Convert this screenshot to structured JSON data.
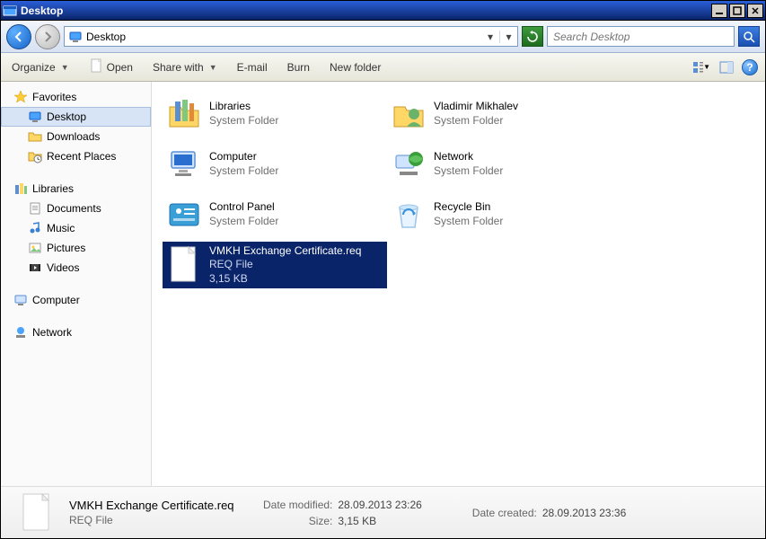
{
  "window": {
    "title": "Desktop"
  },
  "address": {
    "location": "Desktop"
  },
  "search": {
    "placeholder": "Search Desktop"
  },
  "toolbar": {
    "organize": "Organize",
    "open": "Open",
    "share": "Share with",
    "email": "E-mail",
    "burn": "Burn",
    "newfolder": "New folder"
  },
  "sidebar": {
    "favorites": {
      "label": "Favorites",
      "items": [
        {
          "label": "Desktop",
          "icon": "desktop",
          "selected": true
        },
        {
          "label": "Downloads",
          "icon": "downloads"
        },
        {
          "label": "Recent Places",
          "icon": "recent"
        }
      ]
    },
    "libraries": {
      "label": "Libraries",
      "items": [
        {
          "label": "Documents",
          "icon": "documents"
        },
        {
          "label": "Music",
          "icon": "music"
        },
        {
          "label": "Pictures",
          "icon": "pictures"
        },
        {
          "label": "Videos",
          "icon": "videos"
        }
      ]
    },
    "computer": {
      "label": "Computer"
    },
    "network": {
      "label": "Network"
    }
  },
  "items": [
    {
      "name": "Libraries",
      "sub1": "System Folder",
      "icon": "libraries"
    },
    {
      "name": "Vladimir Mikhalev",
      "sub1": "System Folder",
      "icon": "user"
    },
    {
      "name": "Computer",
      "sub1": "System Folder",
      "icon": "computer"
    },
    {
      "name": "Network",
      "sub1": "System Folder",
      "icon": "network"
    },
    {
      "name": "Control Panel",
      "sub1": "System Folder",
      "icon": "controlpanel"
    },
    {
      "name": "Recycle Bin",
      "sub1": "System Folder",
      "icon": "recyclebin"
    },
    {
      "name": "VMKH Exchange Certificate.req",
      "sub1": "REQ File",
      "sub2": "3,15 KB",
      "icon": "file",
      "selected": true
    }
  ],
  "details": {
    "name": "VMKH Exchange Certificate.req",
    "type": "REQ File",
    "modified_label": "Date modified:",
    "modified": "28.09.2013 23:26",
    "size_label": "Size:",
    "size": "3,15 KB",
    "created_label": "Date created:",
    "created": "28.09.2013 23:36"
  }
}
